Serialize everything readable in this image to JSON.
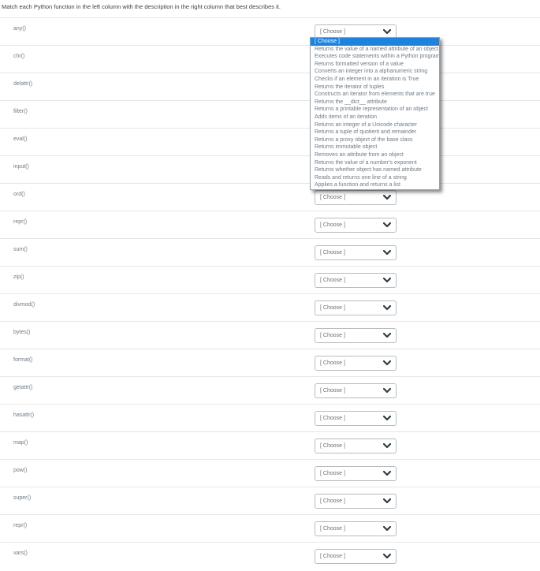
{
  "instruction": "Match each Python function in the left column with the description in the right column that best describes it.",
  "table": {
    "select_placeholder": "[ Choose ]",
    "functions": [
      "any()",
      "chr()",
      "delattr()",
      "filter()",
      "eval()",
      "input()",
      "ord()",
      "repr()",
      "sum()",
      "zip()",
      "divmod()",
      "bytes()",
      "format()",
      "getattr()",
      "hasattr()",
      "map()",
      "pow()",
      "super()",
      "repr()",
      "vars()"
    ]
  },
  "open_dropdown": {
    "attached_row_index": 0,
    "highlighted_option": "[ Choose ]",
    "options": [
      "[ Choose ]",
      "Returns the value of a named attribute of an object",
      "Executes code statements within a Python program",
      "Returns formatted version of a value",
      "Converts an integer into a alphanumeric string",
      "Checks if an element in an iteration is True",
      "Returns the iterator of tuples",
      "Constructs an iterator from elements that are true",
      "Returns the __dict__ attribute",
      "Returns a printable representation of an object",
      "Adds items of an iteration",
      "Returns an integer of a Unicode character",
      "Returns a tuple of quotient and remainder",
      "Returns a proxy object of the base class",
      "Returns immutable object",
      "Removes an attribute from an object",
      "Returns the value of a number's exponent",
      "Returns whether object has named attribute",
      "Reads and returns one line of a string",
      "Applies a function and returns a list"
    ]
  },
  "colors": {
    "highlight_bg": "#1e82e0",
    "highlight_text": "#ffffff",
    "option_text": "#6d7b87",
    "label_text": "#6e7b85",
    "instruction_text": "#3a3f44",
    "select_border": "#b7bcbf",
    "row_divider": "#e6e6e6",
    "chevron": "#2d3b45"
  }
}
